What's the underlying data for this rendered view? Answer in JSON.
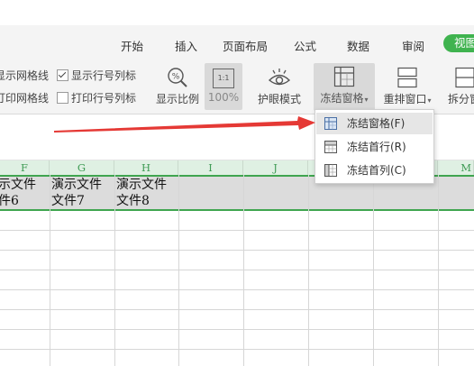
{
  "tabs": [
    {
      "label": "开始"
    },
    {
      "label": "插入"
    },
    {
      "label": "页面布局"
    },
    {
      "label": "公式"
    },
    {
      "label": "数据"
    },
    {
      "label": "审阅"
    },
    {
      "label": "视图"
    }
  ],
  "ribbon": {
    "show_gridlines": "显示网格线",
    "show_rowcol": "显示行号列标",
    "print_gridlines": "打印网格线",
    "print_rowcol": "打印行号列标",
    "zoom_label": "显示比例",
    "zoom_icon_text": "1:1",
    "zoom_value": "100%",
    "eye_mode": "护眼模式",
    "freeze": "冻结窗格",
    "arrange": "重排窗口",
    "split": "拆分窗"
  },
  "menu": {
    "items": [
      {
        "label": "冻结窗格(F)"
      },
      {
        "label": "冻结首行(R)"
      },
      {
        "label": "冻结首列(C)"
      }
    ]
  },
  "columns": [
    "F",
    "G",
    "H",
    "I",
    "J",
    "M"
  ],
  "cells": {
    "f1": "示文件",
    "f2": "件6",
    "g1": "演示文件",
    "g2": "文件7",
    "h1": "演示文件",
    "h2": "文件8"
  },
  "colors": {
    "accent_green": "#3fb34f",
    "arrow_red": "#e53935"
  }
}
